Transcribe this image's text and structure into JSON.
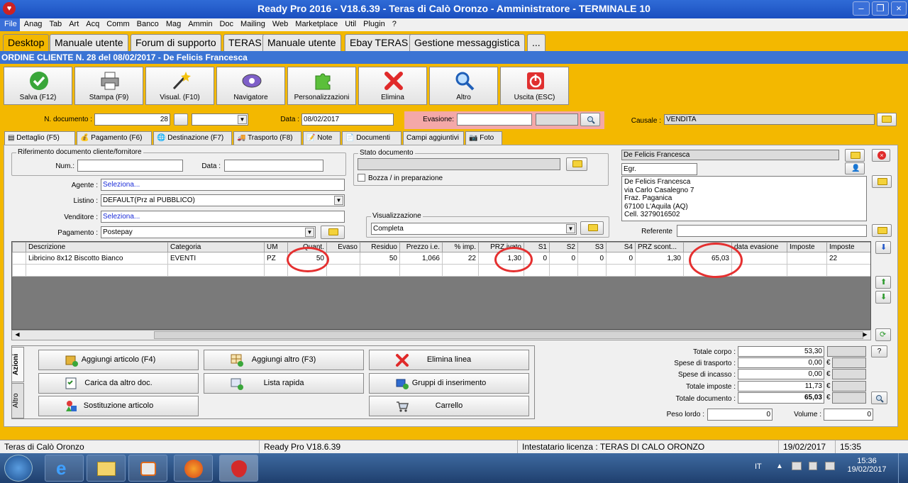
{
  "window": {
    "title": "Ready Pro 2016 - V18.6.39 - Teras di Calò Oronzo - Amministratore - TERMINALE 10"
  },
  "menu": [
    "File",
    "Anag",
    "Tab",
    "Art",
    "Acq",
    "Comm",
    "Banco",
    "Mag",
    "Ammin",
    "Doc",
    "Mailing",
    "Web",
    "Marketplace",
    "Util",
    "Plugin",
    "?"
  ],
  "main_tabs": [
    "Desktop",
    "Manuale utente",
    "Forum di supporto",
    "TERAS",
    "Manuale utente",
    "Ebay TERAS",
    "Gestione messaggistica",
    "..."
  ],
  "document_title": "ORDINE CLIENTE N. 28 del 08/02/2017 - De Felicis Francesca",
  "toolbar": [
    "Salva (F12)",
    "Stampa (F9)",
    "Visual. (F10)",
    "Navigatore",
    "Personalizzazioni",
    "Elimina",
    "Altro",
    "Uscita (ESC)"
  ],
  "header": {
    "n_documento_label": "N. documento :",
    "n_documento": "28",
    "data_label": "Data :",
    "data": "08/02/2017",
    "evasione_label": "Evasione:",
    "causale_label": "Causale :",
    "causale": "VENDITA"
  },
  "subtabs": [
    "Dettaglio (F5)",
    "Pagamento (F6)",
    "Destinazione (F7)",
    "Trasporto (F8)",
    "Note",
    "Documenti",
    "Campi aggiuntivi",
    "Foto"
  ],
  "riferimento": {
    "title": "Riferimento documento cliente/fornitore",
    "num_label": "Num.:",
    "data_label": "Data :"
  },
  "fields": {
    "agente_label": "Agente :",
    "agente": "Seleziona...",
    "listino_label": "Listino :",
    "listino": "DEFAULT(Prz al PUBBLICO)",
    "venditore_label": "Venditore :",
    "venditore": "Seleziona...",
    "pagamento_label": "Pagamento :",
    "pagamento": "Postepay"
  },
  "stato": {
    "title": "Stato documento",
    "bozza": "Bozza / in preparazione"
  },
  "visualizzazione": {
    "title": "Visualizzazione",
    "value": "Completa"
  },
  "cliente": {
    "name": "De Felicis Francesca",
    "salutation": "Egr.",
    "address_lines": [
      "De Felicis Francesca",
      "via Carlo Casalegno 7",
      "Fraz. Paganica",
      "67100 L'Aquila (AQ)",
      "Cell. 3279016502"
    ],
    "referente_label": "Referente"
  },
  "grid": {
    "headers": [
      "Descrizione",
      "Categoria",
      "UM",
      "Quant.",
      "Evaso",
      "Residuo",
      "Prezzo i.e.",
      "% imp.",
      "PRZ ivato",
      "S1",
      "S2",
      "S3",
      "S4",
      "PRZ scont...",
      "",
      "data evasione",
      "Imposte",
      "Imposte"
    ],
    "row": [
      "Libricino 8x12 Biscotto Bianco",
      "EVENTI",
      "PZ",
      "50",
      "",
      "50",
      "1,066",
      "22",
      "1,30",
      "0",
      "0",
      "0",
      "0",
      "1,30",
      "65,03",
      "",
      "",
      "22"
    ]
  },
  "side_tabs": [
    "Azioni",
    "Altro"
  ],
  "actions": [
    "Aggiungi articolo (F4)",
    "Aggiungi altro (F3)",
    "Elimina linea",
    "Carica da altro doc.",
    "Lista rapida",
    "Gruppi di inserimento",
    "Sostituzione articolo",
    "Carrello"
  ],
  "totals": {
    "rows": [
      {
        "label": "Totale corpo :",
        "value": "53,30",
        "unit": ""
      },
      {
        "label": "Spese di trasporto :",
        "value": "0,00",
        "unit": "€"
      },
      {
        "label": "Spese di incasso :",
        "value": "0,00",
        "unit": "€"
      },
      {
        "label": "Totale imposte :",
        "value": "11,73",
        "unit": "€"
      },
      {
        "label": "Totale documento :",
        "value": "65,03",
        "unit": "€"
      }
    ],
    "peso_label": "Peso lordo :",
    "peso": "0",
    "volume_label": "Volume :",
    "volume": "0",
    "help": "?"
  },
  "status": {
    "company": "Teras di Calò Oronzo",
    "version": "Ready Pro V18.6.39",
    "license": "Intestatario licenza : TERAS DI CALO ORONZO",
    "date": "19/02/2017",
    "time": "15:35"
  },
  "taskbar": {
    "lang": "IT",
    "time": "15:36",
    "date": "19/02/2017"
  }
}
